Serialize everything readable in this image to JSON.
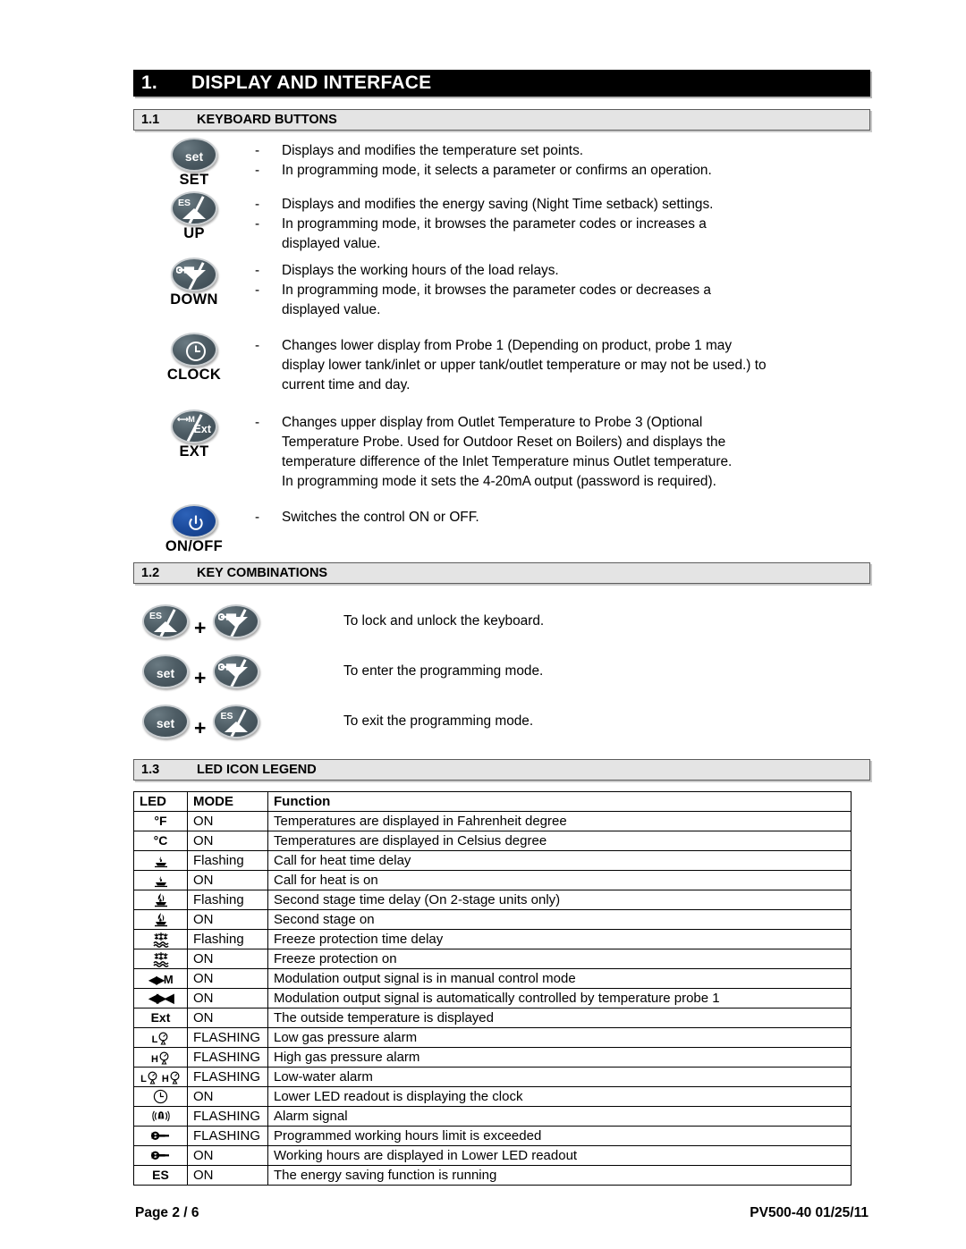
{
  "chapter": {
    "number": "1.",
    "title": "DISPLAY AND INTERFACE"
  },
  "sections": {
    "keyboard_buttons": {
      "number": "1.1",
      "title": "KEYBOARD BUTTONS"
    },
    "key_combinations": {
      "number": "1.2",
      "title": "KEY COMBINATIONS"
    },
    "led_icon_legend": {
      "number": "1.3",
      "title": "LED ICON LEGEND"
    }
  },
  "dash": "-",
  "plus": "+",
  "keyboard_buttons": [
    {
      "key_label": "SET",
      "icon": "set-key-icon",
      "lines": [
        {
          "type": "bullet",
          "text": "Displays and modifies the temperature set points."
        },
        {
          "type": "bullet",
          "text": "In programming mode, it selects a parameter or confirms an operation."
        }
      ]
    },
    {
      "key_label": "UP",
      "icon": "es-up-key-icon",
      "lines": [
        {
          "type": "bullet",
          "text": "Displays and modifies the energy saving (Night Time setback) settings."
        },
        {
          "type": "bullet",
          "text": "In programming mode, it browses the parameter codes or increases a"
        },
        {
          "type": "cont",
          "text": "displayed value."
        }
      ]
    },
    {
      "key_label": "DOWN",
      "icon": "wrench-down-key-icon",
      "lines": [
        {
          "type": "bullet",
          "text": "Displays the working hours of the load relays."
        },
        {
          "type": "bullet",
          "text": "In programming mode, it browses the parameter codes or decreases a"
        },
        {
          "type": "cont",
          "text": "displayed value."
        }
      ]
    },
    {
      "key_label": "CLOCK",
      "icon": "clock-key-icon",
      "lines": [
        {
          "type": "bullet",
          "text": "Changes lower display from Probe 1 (Depending on product, probe 1 may"
        },
        {
          "type": "cont",
          "text": "display lower tank/inlet or upper tank/outlet temperature or may not be used.) to"
        },
        {
          "type": "cont",
          "text": "current time and day."
        }
      ]
    },
    {
      "key_label": "EXT",
      "icon": "modulation-ext-key-icon",
      "lines": [
        {
          "type": "bullet",
          "text": "Changes upper display from Outlet Temperature to Probe 3 (Optional"
        },
        {
          "type": "cont",
          "text": "Temperature Probe. Used for Outdoor Reset on Boilers) and displays the"
        },
        {
          "type": "cont",
          "text": "temperature difference of the Inlet Temperature minus Outlet temperature."
        },
        {
          "type": "cont",
          "text": "In programming mode it sets the 4-20mA output (password is required)."
        }
      ]
    },
    {
      "key_label": "ON/OFF",
      "icon": "power-key-icon",
      "lines": [
        {
          "type": "bullet",
          "text": "Switches the control ON or OFF."
        }
      ]
    }
  ],
  "key_combinations": [
    {
      "first_icon": "es-up-key-icon",
      "second_icon": "wrench-down-key-icon",
      "text": "To lock and unlock the keyboard."
    },
    {
      "first_icon": "set-key-icon",
      "second_icon": "wrench-down-key-icon",
      "text": "To enter the programming mode."
    },
    {
      "first_icon": "set-key-icon",
      "second_icon": "es-up-key-icon",
      "text": "To exit the programming mode."
    }
  ],
  "led_table": {
    "headers": [
      "LED",
      "MODE",
      "Function"
    ],
    "rows": [
      {
        "led_kind": "text",
        "led": "°F",
        "mode": "ON",
        "function": "Temperatures are displayed in Fahrenheit degree"
      },
      {
        "led_kind": "text",
        "led": "°C",
        "mode": "ON",
        "function": "Temperatures are displayed in Celsius degree"
      },
      {
        "led_kind": "glyph",
        "led": "flame-small-icon",
        "mode": "Flashing",
        "function": "Call for heat time delay"
      },
      {
        "led_kind": "glyph",
        "led": "flame-small-icon",
        "mode": "ON",
        "function": "Call for heat is on"
      },
      {
        "led_kind": "glyph",
        "led": "flame-large-icon",
        "mode": "Flashing",
        "function": "Second stage time delay (On 2-stage units only)"
      },
      {
        "led_kind": "glyph",
        "led": "flame-large-icon",
        "mode": "ON",
        "function": "Second stage on"
      },
      {
        "led_kind": "glyph",
        "led": "snowflake-icon",
        "mode": "Flashing",
        "function": "Freeze protection time delay"
      },
      {
        "led_kind": "glyph",
        "led": "snowflake-icon",
        "mode": "ON",
        "function": "Freeze protection on"
      },
      {
        "led_kind": "glyph",
        "led": "modulation-manual-icon",
        "mode": "ON",
        "function": "Modulation output signal is in manual control mode"
      },
      {
        "led_kind": "glyph",
        "led": "modulation-auto-icon",
        "mode": "ON",
        "function": "Modulation output signal is automatically controlled by temperature probe 1"
      },
      {
        "led_kind": "text",
        "led": "Ext",
        "mode": "ON",
        "function": "The outside temperature is displayed"
      },
      {
        "led_kind": "glyph",
        "led": "low-pressure-icon",
        "mode": "FLASHING",
        "function": "Low gas pressure alarm"
      },
      {
        "led_kind": "glyph",
        "led": "high-pressure-icon",
        "mode": "FLASHING",
        "function": "High gas pressure alarm"
      },
      {
        "led_kind": "glyph",
        "led": "low-high-pressure-icon",
        "mode": "FLASHING",
        "function": "Low-water alarm"
      },
      {
        "led_kind": "glyph",
        "led": "clock-icon",
        "mode": "ON",
        "function": "Lower LED readout is displaying the clock"
      },
      {
        "led_kind": "glyph",
        "led": "alarm-bell-icon",
        "mode": "FLASHING",
        "function": "Alarm signal"
      },
      {
        "led_kind": "glyph",
        "led": "wrench-icon",
        "mode": "FLASHING",
        "function": "Programmed working hours limit is exceeded"
      },
      {
        "led_kind": "glyph",
        "led": "wrench-icon",
        "mode": "ON",
        "function": "Working hours are displayed in Lower LED readout"
      },
      {
        "led_kind": "text",
        "led": "ES",
        "mode": "ON",
        "function": "The energy saving function is running"
      }
    ]
  },
  "footer": {
    "page": "Page 2 / 6",
    "document_ref": "PV500-40  01/25/11"
  }
}
